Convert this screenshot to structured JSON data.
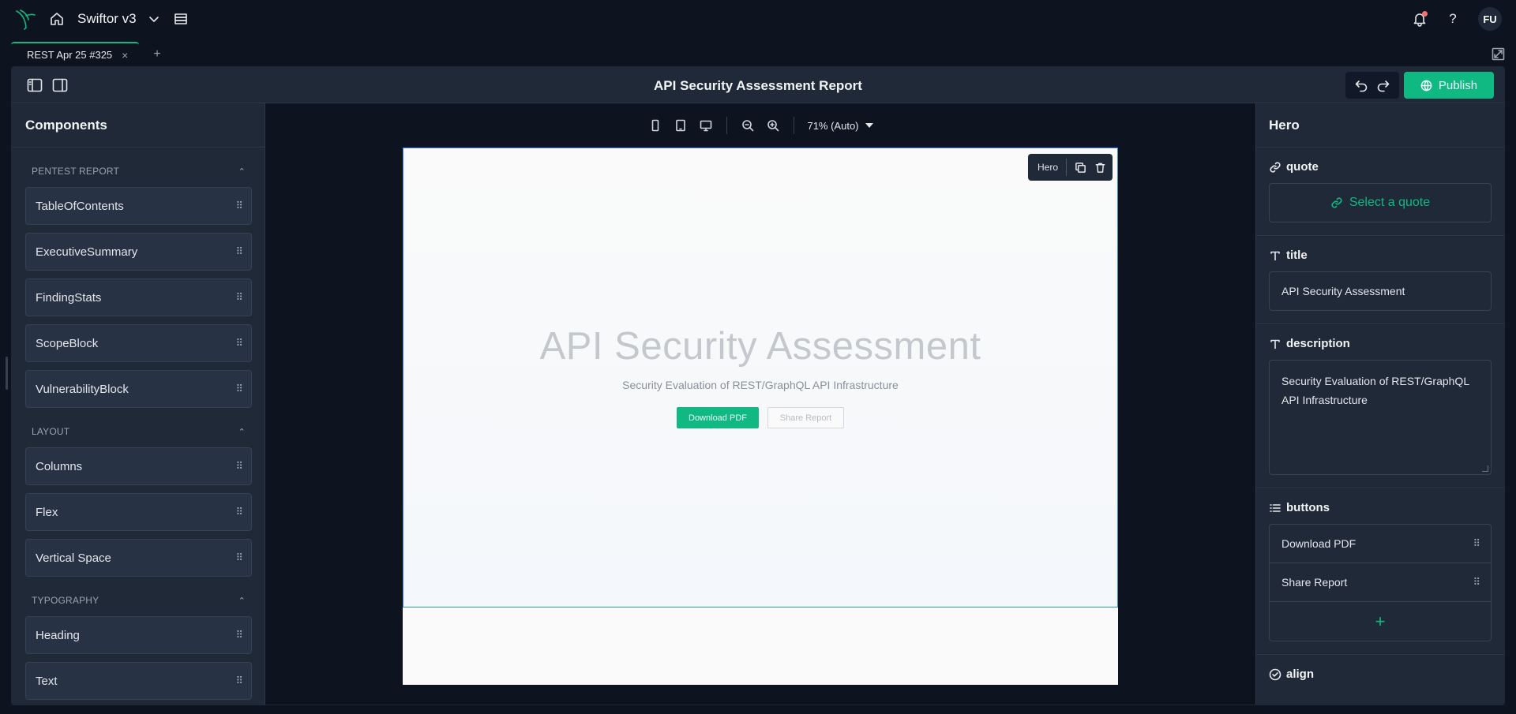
{
  "topbar": {
    "app_title": "Swiftor v3",
    "avatar_initials": "FU",
    "help_glyph": "?",
    "icons": [
      "logo-icon",
      "home-icon",
      "chevron-down-icon",
      "stack-icon",
      "bell-icon",
      "help-icon"
    ]
  },
  "tabs": [
    {
      "label": "REST Apr 25 #325",
      "close": "×"
    }
  ],
  "tab_add": "+",
  "editor": {
    "doc_title": "API Security Assessment Report",
    "publish_label": "Publish"
  },
  "left_panel": {
    "title": "Components",
    "categories": [
      {
        "name": "PENTEST REPORT",
        "items": [
          "TableOfContents",
          "ExecutiveSummary",
          "FindingStats",
          "ScopeBlock",
          "VulnerabilityBlock"
        ]
      },
      {
        "name": "LAYOUT",
        "items": [
          "Columns",
          "Flex",
          "Vertical Space"
        ]
      },
      {
        "name": "TYPOGRAPHY",
        "items": [
          "Heading",
          "Text"
        ]
      }
    ]
  },
  "canvas": {
    "zoom_label": "71% (Auto)",
    "selected_block_label": "Hero",
    "hero": {
      "title": "API Security Assessment",
      "description": "Security Evaluation of REST/GraphQL API Infrastructure",
      "primary_button": "Download PDF",
      "secondary_button": "Share Report"
    }
  },
  "right_panel": {
    "title": "Hero",
    "quote_label": "quote",
    "quote_placeholder": "Select a quote",
    "title_label": "title",
    "title_value": "API Security Assessment",
    "description_label": "description",
    "description_value": "Security Evaluation of REST/GraphQL API Infrastructure",
    "buttons_label": "buttons",
    "buttons": [
      "Download PDF",
      "Share Report"
    ],
    "add_glyph": "+",
    "align_label": "align"
  },
  "colors": {
    "accent": "#10b981",
    "background": "#0d1420",
    "panel": "#1f2937",
    "notification_dot": "#f87171"
  }
}
